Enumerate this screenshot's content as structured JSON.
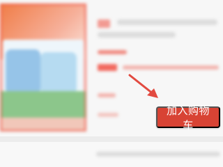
{
  "product": {
    "add_to_cart_label": "加入购物车"
  },
  "colors": {
    "accent": "#d84334",
    "arrow": "#e24a40"
  },
  "icons": {
    "annotation_arrow": "arrow-down-right-icon"
  }
}
